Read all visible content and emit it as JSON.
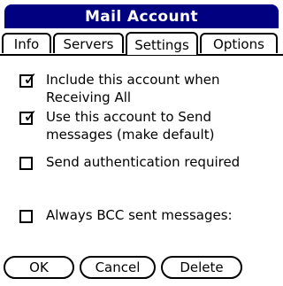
{
  "window": {
    "title": "Mail Account"
  },
  "tabs": [
    {
      "label": "Info",
      "active": false
    },
    {
      "label": "Servers",
      "active": false
    },
    {
      "label": "Settings",
      "active": true
    },
    {
      "label": "Options",
      "active": false
    }
  ],
  "options": [
    {
      "label": "Include this account when Receiving All",
      "checked": true
    },
    {
      "label": "Use this account to Send messages (make default)",
      "checked": true
    },
    {
      "label": "Send authentication required",
      "checked": false
    },
    {
      "label": "Always BCC sent messages:",
      "checked": false
    }
  ],
  "check_glyph": "✓",
  "buttons": {
    "ok": "OK",
    "cancel": "Cancel",
    "delete": "Delete"
  }
}
